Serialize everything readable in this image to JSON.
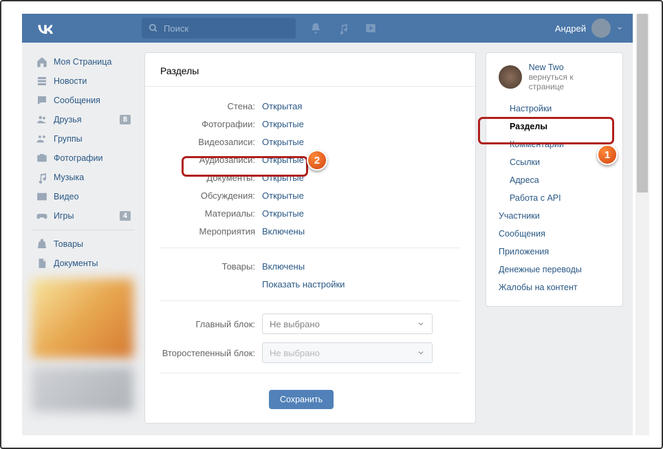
{
  "header": {
    "search_placeholder": "Поиск",
    "username": "Андрей"
  },
  "left_nav": {
    "items": [
      {
        "icon": "home",
        "label": "Моя Страница"
      },
      {
        "icon": "feed",
        "label": "Новости"
      },
      {
        "icon": "msg",
        "label": "Сообщения"
      },
      {
        "icon": "friends",
        "label": "Друзья",
        "badge": "8"
      },
      {
        "icon": "group",
        "label": "Группы"
      },
      {
        "icon": "photo",
        "label": "Фотографии"
      },
      {
        "icon": "music",
        "label": "Музыка"
      },
      {
        "icon": "video",
        "label": "Видео"
      },
      {
        "icon": "game",
        "label": "Игры",
        "badge": "4"
      }
    ],
    "items2": [
      {
        "icon": "bag",
        "label": "Товары"
      },
      {
        "icon": "doc",
        "label": "Документы"
      }
    ]
  },
  "main": {
    "title": "Разделы",
    "rows": [
      {
        "label": "Стена:",
        "value": "Открытая"
      },
      {
        "label": "Фотографии:",
        "value": "Открытые"
      },
      {
        "label": "Видеозаписи:",
        "value": "Открытые"
      },
      {
        "label": "Аудиозаписи:",
        "value": "Открытые"
      },
      {
        "label": "Документы:",
        "value": "Открытые"
      },
      {
        "label": "Обсуждения:",
        "value": "Открытые"
      },
      {
        "label": "Материалы:",
        "value": "Открытые"
      },
      {
        "label": "Мероприятия",
        "value": "Включены"
      }
    ],
    "goods": {
      "label": "Товары:",
      "value": "Включены",
      "settings": "Показать настройки"
    },
    "main_block": {
      "label": "Главный блок:",
      "value": "Не выбрано"
    },
    "secondary_block": {
      "label": "Второстепенный блок:",
      "value": "Не выбрано"
    },
    "save": "Сохранить"
  },
  "right": {
    "group_name": "New Two",
    "back": "вернуться к странице",
    "links": [
      {
        "label": "Настройки",
        "sub": true
      },
      {
        "label": "Разделы",
        "sub": true,
        "active": true
      },
      {
        "label": "Комментарии",
        "sub": true
      },
      {
        "label": "Ссылки",
        "sub": true
      },
      {
        "label": "Адреса",
        "sub": true
      },
      {
        "label": "Работа с API",
        "sub": true
      },
      {
        "label": "Участники"
      },
      {
        "label": "Сообщения"
      },
      {
        "label": "Приложения"
      },
      {
        "label": "Денежные переводы"
      },
      {
        "label": "Жалобы на контент"
      }
    ]
  },
  "callouts": {
    "c1": "1",
    "c2": "2"
  }
}
